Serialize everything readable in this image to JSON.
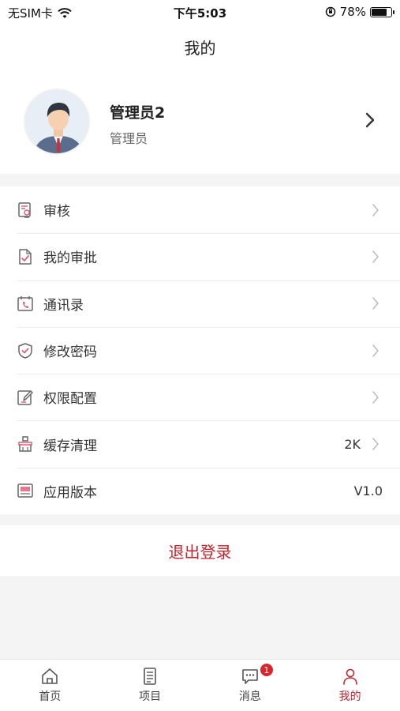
{
  "status_bar": {
    "carrier": "无SIM卡",
    "time": "下午5:03",
    "battery": "78%",
    "battery_level": 0.78
  },
  "nav": {
    "title": "我的"
  },
  "profile": {
    "name": "管理员2",
    "role": "管理员"
  },
  "menu": {
    "items": [
      {
        "label": "审核",
        "icon": "audit-icon"
      },
      {
        "label": "我的审批",
        "icon": "approval-icon"
      },
      {
        "label": "通讯录",
        "icon": "contacts-icon"
      },
      {
        "label": "修改密码",
        "icon": "shield-icon"
      },
      {
        "label": "权限配置",
        "icon": "edit-icon"
      },
      {
        "label": "缓存清理",
        "icon": "broom-icon",
        "value": "2K"
      },
      {
        "label": "应用版本",
        "icon": "version-icon",
        "value": "V1.0"
      }
    ]
  },
  "logout": {
    "label": "退出登录"
  },
  "tabs": {
    "items": [
      {
        "label": "首页",
        "icon": "home-icon"
      },
      {
        "label": "项目",
        "icon": "document-icon"
      },
      {
        "label": "消息",
        "icon": "message-icon",
        "badge": "1"
      },
      {
        "label": "我的",
        "icon": "user-icon",
        "active": true
      }
    ]
  },
  "colors": {
    "accent": "#c8232c",
    "icon_pink": "#e0607a",
    "background": "#f4f4f4"
  }
}
